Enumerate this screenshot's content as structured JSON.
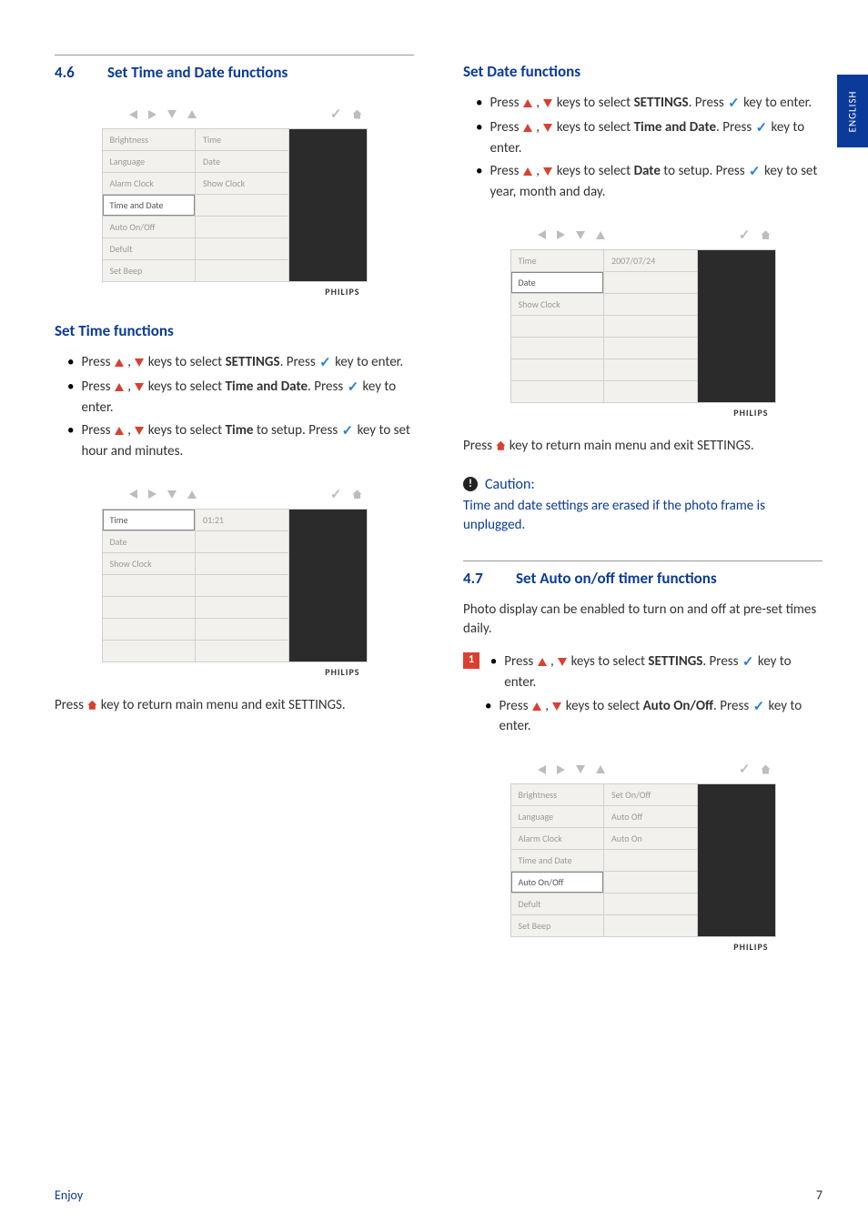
{
  "sideTab": "ENGLISH",
  "section46": {
    "num": "4.6",
    "title": "Set Time and Date functions"
  },
  "screenshot1": {
    "brand": "PHILIPS",
    "left": [
      "Brightness",
      "Language",
      "Alarm Clock",
      "Time and Date",
      "Auto On/Off",
      "Defult",
      "Set Beep"
    ],
    "leftSelIndex": 3,
    "right": [
      "Time",
      "Date",
      "Show Clock",
      "",
      "",
      "",
      ""
    ]
  },
  "setTime": {
    "title": "Set Time functions",
    "b1a": "Press ",
    "b1b": " , ",
    "b1c": " keys to select ",
    "b1bold": "SETTINGS",
    "b1d": ". Press ",
    "b1e": " key to enter.",
    "b2a": "Press ",
    "b2b": " , ",
    "b2c": " keys to select ",
    "b2bold": "Time and Date",
    "b2d": ". Press ",
    "b2e": " key to enter.",
    "b3a": "Press ",
    "b3b": " , ",
    "b3c": " keys to select ",
    "b3bold": "Time",
    "b3d": " to setup. Press ",
    "b3e": " key to set hour and minutes."
  },
  "screenshot2": {
    "brand": "PHILIPS",
    "left": [
      "Time",
      "Date",
      "Show Clock",
      "",
      "",
      "",
      ""
    ],
    "leftSelIndex": 0,
    "right": [
      "01:21",
      "",
      "",
      "",
      "",
      "",
      ""
    ]
  },
  "returnText1a": "Press ",
  "returnText1b": " key to return main menu and exit SETTINGS.",
  "setDate": {
    "title": "Set Date functions",
    "b1a": "Press ",
    "b1b": " , ",
    "b1c": " keys to select ",
    "b1bold": "SETTINGS",
    "b1d": ". Press ",
    "b1e": " key to enter.",
    "b2a": "Press ",
    "b2b": " , ",
    "b2c": " keys to select ",
    "b2bold": "Time and Date",
    "b2d": ". Press ",
    "b2e": " key to enter.",
    "b3a": "Press ",
    "b3b": " , ",
    "b3c": " keys to select ",
    "b3bold": "Date",
    "b3d": " to setup. Press ",
    "b3e": " key to set year, month and day."
  },
  "screenshot3": {
    "brand": "PHILIPS",
    "left": [
      "Time",
      "Date",
      "Show Clock",
      "",
      "",
      "",
      ""
    ],
    "leftSelIndex": 1,
    "right": [
      "2007/07/24",
      "",
      "",
      "",
      "",
      "",
      ""
    ]
  },
  "returnText2a": "Press ",
  "returnText2b": " key to return main menu and exit SETTINGS.",
  "caution": {
    "label": "Caution:",
    "body": "Time and date settings are erased if the photo frame is unplugged."
  },
  "section47": {
    "num": "4.7",
    "title": "Set Auto on/off timer functions",
    "intro": "Photo display can be enabled to turn on and off at pre-set times daily.",
    "step1": "1",
    "b1a": "Press ",
    "b1b": " , ",
    "b1c": " keys to select ",
    "b1bold": "SETTINGS",
    "b1d": ". Press ",
    "b1e": " key to enter.",
    "b2a": "Press ",
    "b2b": " , ",
    "b2c": " keys to select ",
    "b2bold": "Auto On/Off",
    "b2d": ". Press ",
    "b2e": " key to enter."
  },
  "screenshot4": {
    "brand": "PHILIPS",
    "left": [
      "Brightness",
      "Language",
      "Alarm Clock",
      "Time and Date",
      "Auto On/Off",
      "Defult",
      "Set Beep"
    ],
    "leftSelIndex": 4,
    "right": [
      "Set On/Off",
      "Auto Off",
      "Auto On",
      "",
      "",
      "",
      ""
    ]
  },
  "footer": {
    "left": "Enjoy",
    "right": "7"
  }
}
